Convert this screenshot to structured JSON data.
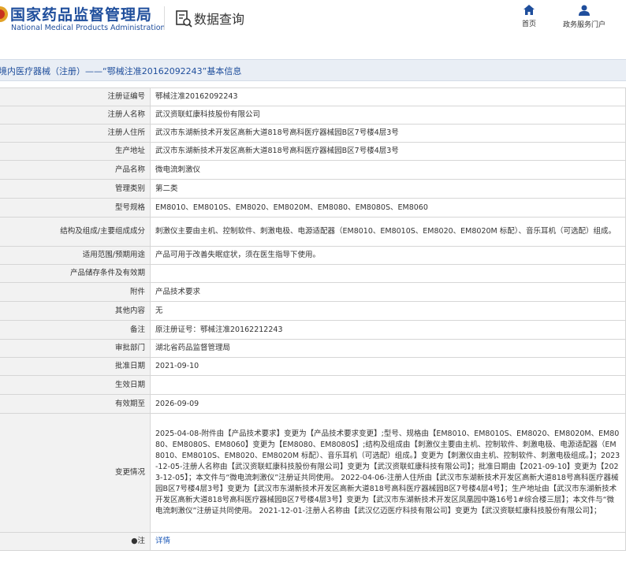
{
  "header": {
    "brand_cn": "国家药品监督管理局",
    "brand_en": "National Medical Products Administration",
    "query_title": "数据查询",
    "nav_home": "首页",
    "nav_portal": "政务服务门户"
  },
  "title_bar": "境内医疗器械（注册）——“鄂械注准20162092243”基本信息",
  "rows": [
    {
      "label": "注册证编号",
      "value": "鄂械注准20162092243"
    },
    {
      "label": "注册人名称",
      "value": "武汉资联虹康科技股份有限公司"
    },
    {
      "label": "注册人住所",
      "value": "武汉市东湖新技术开发区高新大道818号高科医疗器械园B区7号楼4层3号"
    },
    {
      "label": "生产地址",
      "value": "武汉市东湖新技术开发区高新大道818号高科医疗器械园B区7号楼4层3号"
    },
    {
      "label": "产品名称",
      "value": "微电流刺激仪"
    },
    {
      "label": "管理类别",
      "value": "第二类"
    },
    {
      "label": "型号规格",
      "value": "EM8010、EM8010S、EM8020、EM8020M、EM8080、EM8080S、EM8060"
    },
    {
      "label": "结构及组成/主要组成成分",
      "value": "刺激仪主要由主机、控制软件、刺激电极、电源适配器（EM8010、EM8010S、EM8020、EM8020M 标配）、音乐耳机（可选配）组成。"
    },
    {
      "label": "适用范围/预期用途",
      "value": "产品可用于改善失眠症状，须在医生指导下使用。"
    },
    {
      "label": "产品储存条件及有效期",
      "value": ""
    },
    {
      "label": "附件",
      "value": "产品技术要求"
    },
    {
      "label": "其他内容",
      "value": "无"
    },
    {
      "label": "备注",
      "value": "原注册证号：鄂械注准20162212243"
    },
    {
      "label": "审批部门",
      "value": "湖北省药品监督管理局"
    },
    {
      "label": "批准日期",
      "value": "2021-09-10"
    },
    {
      "label": "生效日期",
      "value": ""
    },
    {
      "label": "有效期至",
      "value": "2026-09-09"
    },
    {
      "label": "变更情况",
      "value": "2025-04-08-附件由【产品技术要求】变更为【产品技术要求变更】;型号、规格由【EM8010、EM8010S、EM8020、EM8020M、EM8080、EM8080S、EM8060】变更为【EM8080、EM8080S】;结构及组成由【刺激仪主要由主机、控制软件、刺激电极、电源适配器（EM8010、EM8010S、EM8020、EM8020M 标配）、音乐耳机（可选配）组成。】变更为【刺激仪由主机、控制软件、刺激电极组成。】；2023-12-05-注册人名称由【武汉资联虹康科技股份有限公司】变更为【武汉资联虹康科技有限公司】；批准日期由【2021-09-10】变更为【2023-12-05】；本文件与“微电流刺激仪”注册证共同使用。 2022-04-06-注册人住所由【武汉市东湖新技术开发区高新大道818号高科医疗器械园B区7号楼4层3号】变更为【武汉市东湖新技术开发区高新大道818号高科医疗器械园B区7号楼4层4号】；生产地址由【武汉市东湖新技术开发区高新大道818号高科医疗器械园B区7号楼4层3号】变更为【武汉市东湖新技术开发区凤凰园中路16号1#综合楼三层】；本文件与“微电流刺激仪”注册证共同使用。 2021-12-01-注册人名称由【武汉亿迈医疗科技有限公司】变更为【武汉资联虹康科技股份有限公司】；"
    }
  ],
  "note_row": {
    "label": "●注",
    "link": "详情"
  },
  "colors": {
    "brand": "#1f4e9c",
    "label_bg": "#f2f2f2",
    "title_bar_bg": "#e9eef5",
    "link": "#1f5bb8"
  }
}
